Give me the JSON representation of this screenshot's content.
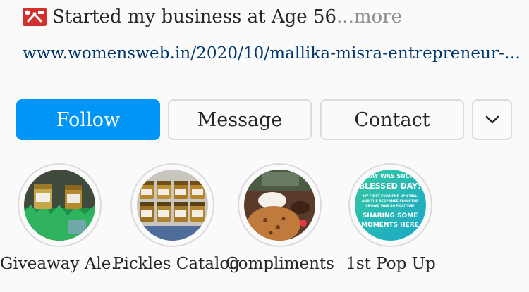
{
  "bio": {
    "emoji_icon": "tools-emoji-icon",
    "text": "Started my business at Age 56",
    "ellipsis": "...",
    "more_label": " more"
  },
  "link": {
    "url_text": "www.womensweb.in/2020/10/mallika-misra-entrepreneur-…"
  },
  "actions": {
    "follow_label": "Follow",
    "message_label": "Message",
    "contact_label": "Contact",
    "more_icon": "chevron-down-icon"
  },
  "colors": {
    "follow_bg": "#0095f6",
    "link": "#00376b",
    "muted": "#8e8e8e"
  },
  "highlights": [
    {
      "label": "Giveaway Ale…",
      "thumb": "pickle-jars-on-green-grass"
    },
    {
      "label": "Pickles Catalog",
      "thumb": "rows-of-pickle-jars"
    },
    {
      "label": "Compliments",
      "thumb": "paratha-with-curd-and-note"
    },
    {
      "label": "1st Pop Up",
      "thumb": "blessed-day-text-card",
      "thumb_text": [
        "DAY WAS SUCH",
        "BLESSED DAY!",
        "MY FIRST EVER POP UP STALL",
        "AND THE RESPONSE FROM THE",
        "CROWD WAS SO POSITIVE!",
        "SHARING SOME",
        "MOMENTS HERE"
      ]
    }
  ]
}
